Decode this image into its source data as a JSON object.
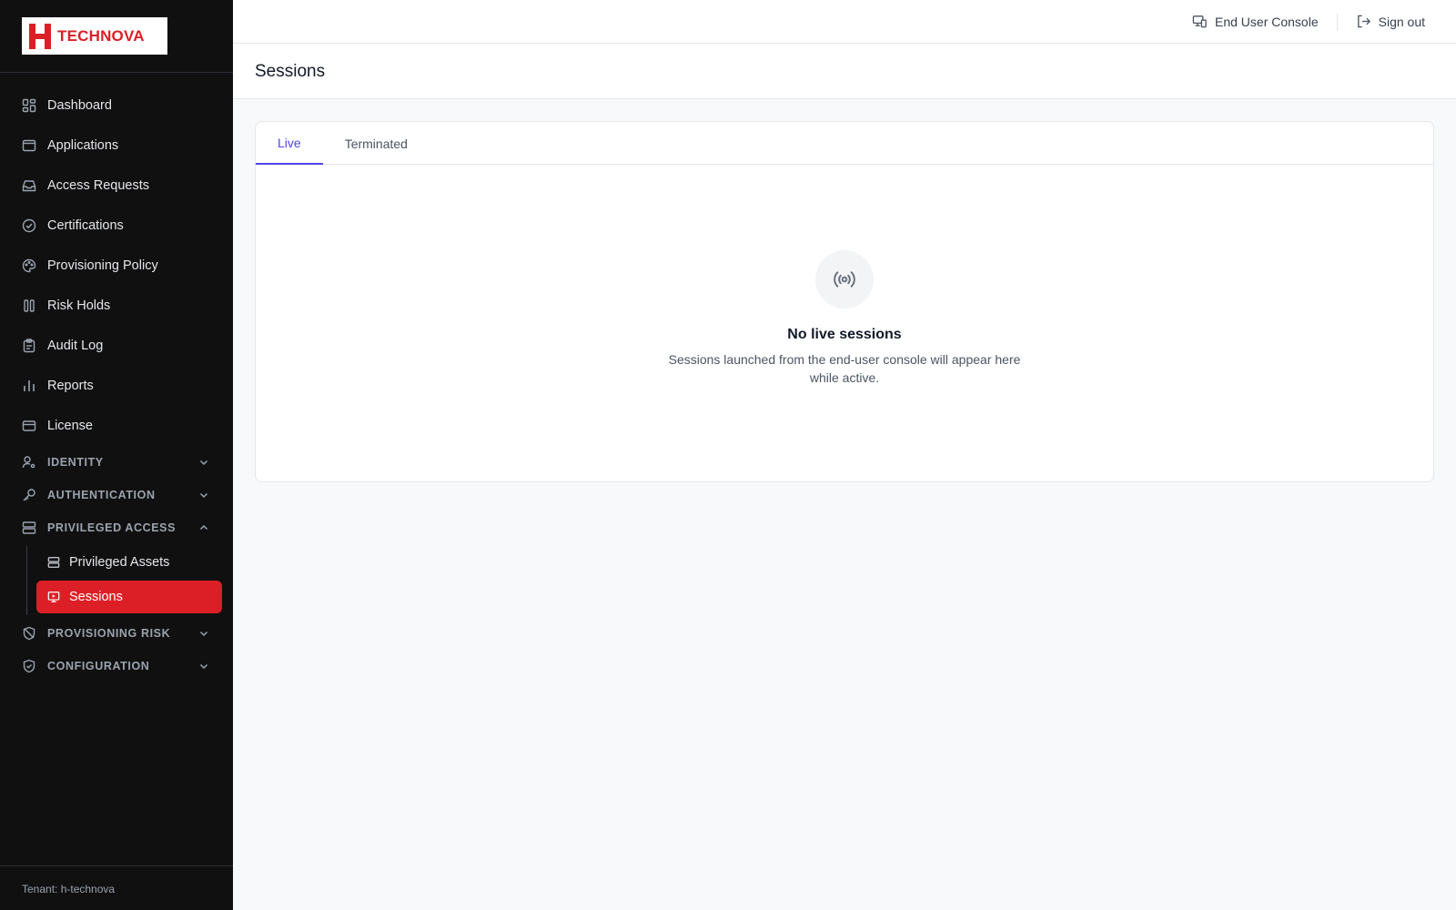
{
  "brand": {
    "name": "TECHNOVA",
    "color": "#dc1f26"
  },
  "sidebar": {
    "items": [
      {
        "label": "Dashboard",
        "icon": "dashboard-icon"
      },
      {
        "label": "Applications",
        "icon": "browser-window-icon"
      },
      {
        "label": "Access Requests",
        "icon": "inbox-icon"
      },
      {
        "label": "Certifications",
        "icon": "check-circle-icon"
      },
      {
        "label": "Provisioning Policy",
        "icon": "palette-icon"
      },
      {
        "label": "Risk Holds",
        "icon": "pause-icon"
      },
      {
        "label": "Audit Log",
        "icon": "clipboard-icon"
      },
      {
        "label": "Reports",
        "icon": "bar-chart-icon"
      },
      {
        "label": "License",
        "icon": "credit-card-icon"
      }
    ],
    "groups": [
      {
        "label": "IDENTITY",
        "icon": "user-gear-icon",
        "expanded": false
      },
      {
        "label": "AUTHENTICATION",
        "icon": "key-icon",
        "expanded": false
      },
      {
        "label": "PRIVILEGED ACCESS",
        "icon": "server-icon",
        "expanded": true
      },
      {
        "label": "PROVISIONING RISK",
        "icon": "shield-off-icon",
        "expanded": false
      },
      {
        "label": "CONFIGURATION",
        "icon": "shield-check-icon",
        "expanded": false
      }
    ],
    "privileged_access_items": [
      {
        "label": "Privileged Assets",
        "icon": "server-icon",
        "active": false
      },
      {
        "label": "Sessions",
        "icon": "monitor-play-icon",
        "active": true
      }
    ],
    "tenant": "Tenant: h-technova",
    "active_color": "#dc1f26"
  },
  "topbar": {
    "end_user_console": "End User Console",
    "sign_out": "Sign out"
  },
  "page": {
    "title": "Sessions"
  },
  "tabs": [
    {
      "label": "Live",
      "active": true
    },
    {
      "label": "Terminated",
      "active": false
    }
  ],
  "tab_accent": "#4f46e5",
  "empty_state": {
    "icon": "broadcast-icon",
    "title": "No live sessions",
    "description": "Sessions launched from the end-user console will appear here while active."
  }
}
